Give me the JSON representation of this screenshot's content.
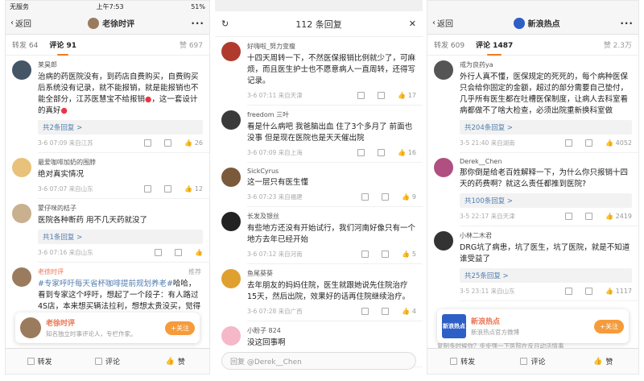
{
  "colors": {
    "accent": "#f07a1a",
    "link": "#507daf",
    "vip": "#eb7350",
    "follow": "#f59b3b"
  },
  "left": {
    "status": {
      "carrier": "无服务",
      "wifi": "wifi-icon",
      "time": "上午7:53",
      "battery": "51%"
    },
    "nav": {
      "back": "返回",
      "title": "老徐时评",
      "more": "···"
    },
    "tabs": {
      "repost": "转发 64",
      "comment": "评论 91",
      "likes": "赞 697"
    },
    "comments": [
      {
        "name": "莱昊郎",
        "text_parts": [
          "治病的药医院没有，到药店自费购买，自费购买后系统没有记录，就不能报销，就是",
          "能报销也不能全部分，江苏医慧宝不给报销",
          "，这一套设计的真好"
        ],
        "reply": "共2条回复 >",
        "time": "3-6 07:09",
        "from": "来自江苏",
        "likes": "26"
      },
      {
        "name": "最爱咖啡加奶的围脖",
        "text": "绝对真实情况",
        "time": "3-6 07:07",
        "from": "来自山东",
        "likes": "12"
      },
      {
        "name": "蒙仔咪的桔子",
        "text": "医院各种断药  用不几天药就没了",
        "reply": "共1条回复 >",
        "time": "3-6 07:16",
        "from": "来自山东",
        "likes": ""
      },
      {
        "name": "老徐时评",
        "pin": "推荐",
        "hashtag": "#专家呼吁每天省杯咖啡提前规划养老#",
        "text": "哈哈，看到专家这个呼吁，想起了一个段子：有人路过4S店，本来想买辆法拉利，想想太贵没买，觉得今天一下子省了几百万。钱不是省出来的，是拼命"
      }
    ],
    "card": {
      "name": "老徐时评",
      "desc": "知名独立时事评论人，专栏作家。",
      "follow": "+关注"
    },
    "bottom": {
      "repost": "转发",
      "comment": "评论",
      "like": "赞"
    }
  },
  "middle": {
    "head": {
      "title": "112 条回复",
      "refresh": "refresh-icon",
      "close": "close-icon"
    },
    "comments": [
      {
        "name": "好嗨啦_努力变瘦",
        "text": "十四天周转一下，不然医保报销比例就少了，可麻烦，而且医生护士也不愿意病人一直周转，还得写记录。",
        "time": "3-6 07:11",
        "from": "来自天津",
        "likes": "17"
      },
      {
        "name": "freedom 三叶",
        "text": "看是什么病吧  我爸脑出血 住了3个多月了  前面也没事  但是现在医院也是天天催出院",
        "time": "3-6 07:09",
        "from": "来自上海",
        "likes": "16"
      },
      {
        "name": "SickCyrus",
        "text": "这一层只有医生懂",
        "time": "3-6 07:23",
        "from": "来自福建",
        "likes": "9"
      },
      {
        "name": "长发及银丝",
        "text": "有些地方还没有开始试行，我们河南好像只有一个地方去年已经开始",
        "time": "3-6 07:12",
        "from": "来自河南",
        "likes": "5"
      },
      {
        "name": "鱼尾葵葵",
        "text": "去年朋友的妈妈住院，医生就跟她说先住院治疗15天，然后出院，效果好的话再住院继续治疗。",
        "time": "3-6 07:28",
        "from": "来自广西",
        "likes": "4"
      },
      {
        "name": "小盼子 824",
        "text": "没这回事啊",
        "time": "3-6 07:13",
        "from": "来自海南",
        "likes": ""
      }
    ],
    "input_placeholder": "回复 @Derek__Chen"
  },
  "right": {
    "nav": {
      "back": "返回",
      "title": "新浪热点",
      "more": "···"
    },
    "tabs": {
      "repost": "转发 609",
      "comment": "评论 1487",
      "likes": "赞 2.3万"
    },
    "comments": [
      {
        "name": "戒为良药ya",
        "text": "外行人真不懂，医保规定的死死的，每个病种医保只会给你固定的金额，超过的部分需要自己垫付，几乎所有医生都在吐槽医保制度，让病人去科室看病都做不了啥大检查，必须出院重新换科室做",
        "reply": "共204条回复 >",
        "time": "3-5 21:40",
        "from": "来自湖南",
        "likes": "4052"
      },
      {
        "name": "Derek__Chen",
        "text": "那你倒是给老百姓解释一下，为什么你只报销十四天的药费啊？就这么责任都推到医院?",
        "reply": "共100条回复 >",
        "time": "3-5 22:17",
        "from": "来自天津",
        "likes": "2419"
      },
      {
        "name": "小林二木君",
        "text": "DRG坑了病患，坑了医生，坑了医院，就是不知道谁受益了",
        "reply": "共25条回复 >",
        "time": "3-5 23:11",
        "from": "来自山东",
        "likes": "1117"
      }
    ],
    "card": {
      "badge": "新浪热点",
      "name": "新浪热点",
      "desc": "新浪热点官方微博",
      "follow": "+关注",
      "overflow": "复制多时候你？步步强一下医院在反月动活情事"
    },
    "bottom": {
      "repost": "转发",
      "comment": "评论",
      "like": "赞"
    }
  }
}
